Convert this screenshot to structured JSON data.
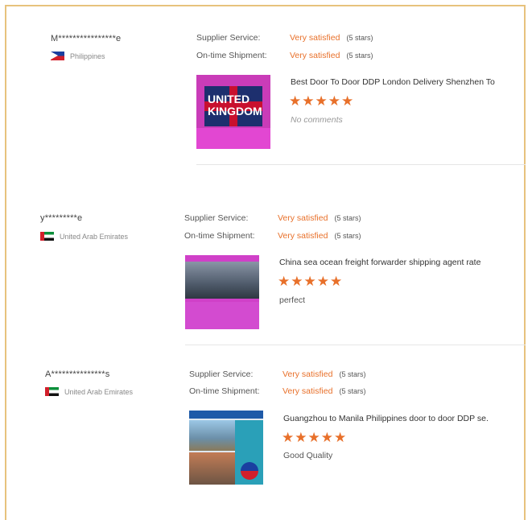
{
  "labels": {
    "supplier_service": "Supplier Service:",
    "ontime_shipment": "On-time Shipment:"
  },
  "reviews": [
    {
      "buyer": "M****************e",
      "country": "Philippines",
      "flag_icon": "philippines-flag-icon",
      "supplier_value": "Very satisfied",
      "supplier_stars": "(5 stars)",
      "shipment_value": "Very satisfied",
      "shipment_stars": "(5 stars)",
      "product_title": "Best Door To Door DDP London Delivery Shenzhen To",
      "rating": 5,
      "stars_display": "★★★★★",
      "comment": "No comments",
      "thumb_text": "UNITED\nKINGDOM"
    },
    {
      "buyer": "y*********e",
      "country": "United Arab Emirates",
      "flag_icon": "uae-flag-icon",
      "supplier_value": "Very satisfied",
      "supplier_stars": "(5 stars)",
      "shipment_value": "Very satisfied",
      "shipment_stars": "(5 stars)",
      "product_title": "China sea ocean freight forwarder shipping agent rate",
      "rating": 5,
      "stars_display": "★★★★★",
      "comment": "perfect"
    },
    {
      "buyer": "A***************s",
      "country": "United Arab Emirates",
      "flag_icon": "uae-flag-icon",
      "supplier_value": "Very satisfied",
      "supplier_stars": "(5 stars)",
      "shipment_value": "Very satisfied",
      "shipment_stars": "(5 stars)",
      "product_title": "Guangzhou to Manila Philippines door to door DDP se.",
      "rating": 5,
      "stars_display": "★★★★★",
      "comment": "Good Quality"
    }
  ],
  "colors": {
    "accent": "#e8702a",
    "frame": "#e7c27d"
  }
}
